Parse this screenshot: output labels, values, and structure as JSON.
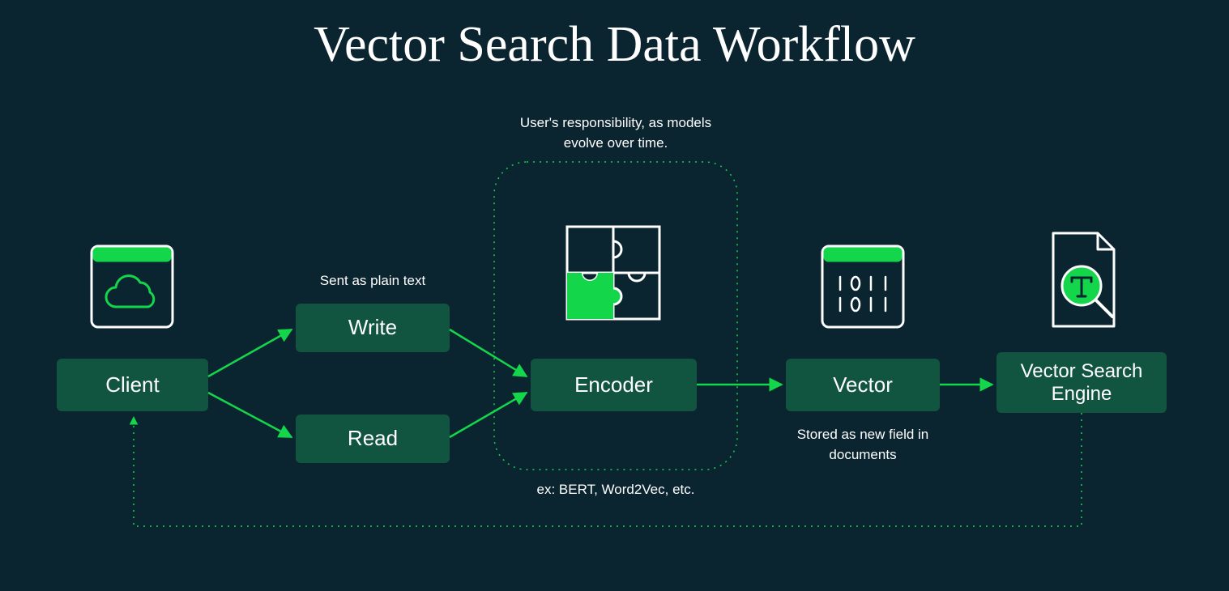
{
  "title": "Vector Search Data Workflow",
  "nodes": {
    "client": "Client",
    "write": "Write",
    "read": "Read",
    "encoder": "Encoder",
    "vector": "Vector",
    "engine": "Vector Search Engine"
  },
  "annotations": {
    "sent_as": "Sent as plain text",
    "user_resp": "User's responsibility, as models evolve over time.",
    "encoder_ex": "ex: BERT, Word2Vec, etc.",
    "stored_as": "Stored as new field in documents"
  },
  "colors": {
    "bg": "#0a2430",
    "box": "#11543f",
    "accent": "#14d64b",
    "text": "#ffffff"
  }
}
